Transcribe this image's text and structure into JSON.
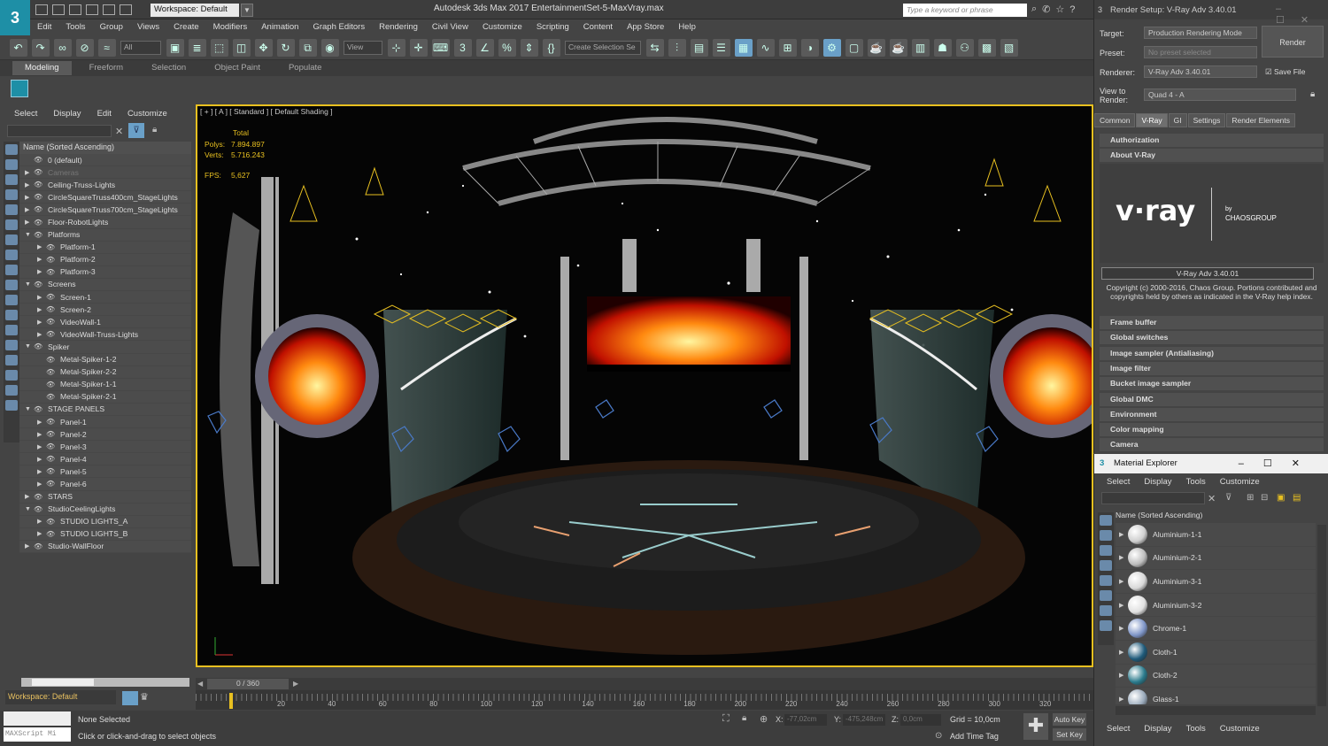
{
  "title_bar": {
    "logo": "3",
    "workspace": "Workspace: Default",
    "app_title": "Autodesk 3ds Max 2017      EntertainmentSet-5-MaxVray.max",
    "search_placeholder": "Type a keyword or phrase"
  },
  "menu": [
    "Edit",
    "Tools",
    "Group",
    "Views",
    "Create",
    "Modifiers",
    "Animation",
    "Graph Editors",
    "Rendering",
    "Civil View",
    "Customize",
    "Scripting",
    "Content",
    "App Store",
    "Help"
  ],
  "toolbar": {
    "selection_filter": "All",
    "reference_coord": "View",
    "named_selection": "Create Selection Se"
  },
  "ribbon_tabs": [
    "Modeling",
    "Freeform",
    "Selection",
    "Object Paint",
    "Populate"
  ],
  "scene_explorer": {
    "menu": [
      "Select",
      "Display",
      "Edit",
      "Customize"
    ],
    "column_header": "Name (Sorted Ascending)",
    "rows": [
      {
        "label": "0 (default)",
        "level": 1,
        "arrow": "",
        "dim": false
      },
      {
        "label": "Cameras",
        "level": 1,
        "arrow": "▶",
        "dim": true
      },
      {
        "label": "Ceiling-Truss-Lights",
        "level": 1,
        "arrow": "▶",
        "dim": false
      },
      {
        "label": "CircleSquareTruss400cm_StageLights",
        "level": 1,
        "arrow": "▶",
        "dim": false
      },
      {
        "label": "CircleSquareTruss700cm_StageLights",
        "level": 1,
        "arrow": "▶",
        "dim": false
      },
      {
        "label": "Floor-RobotLights",
        "level": 1,
        "arrow": "▶",
        "dim": false
      },
      {
        "label": "Platforms",
        "level": 1,
        "arrow": "▼",
        "dim": false
      },
      {
        "label": "Platform-1",
        "level": 2,
        "arrow": "▶",
        "dim": false
      },
      {
        "label": "Platform-2",
        "level": 2,
        "arrow": "▶",
        "dim": false
      },
      {
        "label": "Platform-3",
        "level": 2,
        "arrow": "▶",
        "dim": false
      },
      {
        "label": "Screens",
        "level": 1,
        "arrow": "▼",
        "dim": false
      },
      {
        "label": "Screen-1",
        "level": 2,
        "arrow": "▶",
        "dim": false
      },
      {
        "label": "Screen-2",
        "level": 2,
        "arrow": "▶",
        "dim": false
      },
      {
        "label": "VideoWall-1",
        "level": 2,
        "arrow": "▶",
        "dim": false
      },
      {
        "label": "VideoWall-Truss-Lights",
        "level": 2,
        "arrow": "▶",
        "dim": false
      },
      {
        "label": "Spiker",
        "level": 1,
        "arrow": "▼",
        "dim": false
      },
      {
        "label": "Metal-Spiker-1-2",
        "level": 2,
        "arrow": "",
        "dim": false
      },
      {
        "label": "Metal-Spiker-2-2",
        "level": 2,
        "arrow": "",
        "dim": false
      },
      {
        "label": "Metal-Spiker-1-1",
        "level": 2,
        "arrow": "",
        "dim": false
      },
      {
        "label": "Metal-Spiker-2-1",
        "level": 2,
        "arrow": "",
        "dim": false
      },
      {
        "label": "STAGE PANELS",
        "level": 1,
        "arrow": "▼",
        "dim": false
      },
      {
        "label": "Panel-1",
        "level": 2,
        "arrow": "▶",
        "dim": false
      },
      {
        "label": "Panel-2",
        "level": 2,
        "arrow": "▶",
        "dim": false
      },
      {
        "label": "Panel-3",
        "level": 2,
        "arrow": "▶",
        "dim": false
      },
      {
        "label": "Panel-4",
        "level": 2,
        "arrow": "▶",
        "dim": false
      },
      {
        "label": "Panel-5",
        "level": 2,
        "arrow": "▶",
        "dim": false
      },
      {
        "label": "Panel-6",
        "level": 2,
        "arrow": "▶",
        "dim": false
      },
      {
        "label": "STARS",
        "level": 1,
        "arrow": "▶",
        "dim": false
      },
      {
        "label": "StudioCeelingLights",
        "level": 1,
        "arrow": "▼",
        "dim": false
      },
      {
        "label": "STUDIO LIGHTS_A",
        "level": 2,
        "arrow": "▶",
        "dim": false
      },
      {
        "label": "STUDIO LIGHTS_B",
        "level": 2,
        "arrow": "▶",
        "dim": false
      },
      {
        "label": "Studio-WallFloor",
        "level": 1,
        "arrow": "▶",
        "dim": false
      }
    ],
    "workspace_label": "Workspace: Default"
  },
  "viewport": {
    "label": "[ + ] [ A ] [ Standard ] [ Default Shading ]",
    "stats": {
      "total": "Total",
      "polys_label": "Polys:",
      "polys": "7.894.897",
      "verts_label": "Verts:",
      "verts": "5.716.243",
      "fps_label": "FPS:",
      "fps": "5,627"
    }
  },
  "timeline": {
    "frame": "0 / 360",
    "ticks": [
      "20",
      "40",
      "60",
      "80",
      "100",
      "120",
      "140",
      "160",
      "180",
      "200",
      "220",
      "240",
      "260",
      "280",
      "300",
      "320"
    ]
  },
  "status": {
    "maxscript": "MAXScript Mi",
    "selection": "None Selected",
    "hint": "Click or click-and-drag to select objects",
    "x_label": "X:",
    "x": "-77,02cm",
    "y_label": "Y:",
    "y": "-475,248cm",
    "z_label": "Z:",
    "z": "0,0cm",
    "grid": "Grid = 10,0cm",
    "add_time_tag": "Add Time Tag",
    "auto_key": "Auto Key",
    "set_key": "Set Key"
  },
  "render_setup": {
    "title": "Render Setup: V-Ray Adv 3.40.01",
    "target_label": "Target:",
    "target": "Production Rendering Mode",
    "preset_label": "Preset:",
    "preset": "No preset selected",
    "renderer_label": "Renderer:",
    "renderer": "V-Ray Adv 3.40.01",
    "save_file": "Save File",
    "view_label": "View to Render:",
    "view": "Quad 4 - A",
    "render_button": "Render",
    "tabs": [
      "Common",
      "V-Ray",
      "GI",
      "Settings",
      "Render Elements"
    ],
    "rollouts_top": [
      "Authorization",
      "About V-Ray"
    ],
    "vray_logo": "v·ray",
    "chaos_by": "by",
    "chaos": "CHAOSGROUP",
    "version": "V-Ray Adv 3.40.01",
    "copyright": "Copyright (c) 2000-2016, Chaos Group. Portions contributed and copyrights held by others as indicated in the V-Ray help index.",
    "rollouts": [
      "Frame buffer",
      "Global switches",
      "Image sampler (Antialiasing)",
      "Image filter",
      "Bucket image sampler",
      "Global DMC",
      "Environment",
      "Color mapping",
      "Camera"
    ]
  },
  "material_explorer": {
    "title": "Material Explorer",
    "menu": [
      "Select",
      "Display",
      "Tools",
      "Customize"
    ],
    "column_header": "Name (Sorted Ascending)",
    "items": [
      {
        "label": "Aluminium-1-1",
        "color": "#cfcfcf"
      },
      {
        "label": "Aluminium-2-1",
        "color": "#bdbdbd"
      },
      {
        "label": "Aluminium-3-1",
        "color": "#d8d8d8"
      },
      {
        "label": "Aluminium-3-2",
        "color": "#e0e0e0"
      },
      {
        "label": "Chrome-1",
        "color": "#7f96c8"
      },
      {
        "label": "Cloth-1",
        "color": "#1e5a7a"
      },
      {
        "label": "Cloth-2",
        "color": "#2a7a8c"
      },
      {
        "label": "Glass-1",
        "color": "#9aaabb"
      }
    ]
  }
}
